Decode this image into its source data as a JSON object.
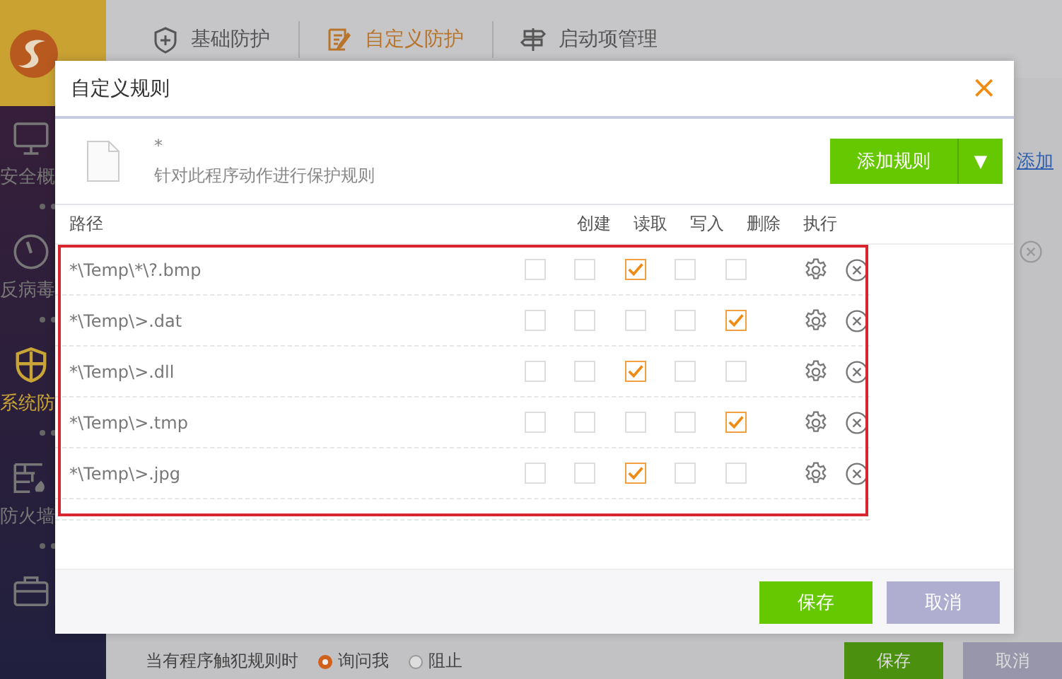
{
  "sidebar": {
    "items": [
      {
        "label": "安全概",
        "selected": false
      },
      {
        "label": "反病毒",
        "selected": false
      },
      {
        "label": "系统防",
        "selected": true
      },
      {
        "label": "防火墙",
        "selected": false
      },
      {
        "selected": false
      }
    ]
  },
  "tabs": [
    {
      "label": "基础防护",
      "selected": false
    },
    {
      "label": "自定义防护",
      "selected": true
    },
    {
      "label": "启动项管理",
      "selected": false
    }
  ],
  "background": {
    "link": "添加",
    "footer_label": "当有程序触犯规则时",
    "radios": [
      {
        "label": "询问我",
        "selected": true
      },
      {
        "label": "阻止",
        "selected": false
      }
    ],
    "buttons": [
      "保存",
      "取消"
    ]
  },
  "dialog": {
    "title": "自定义规则",
    "close": "×",
    "program": {
      "name": "*",
      "description": "针对此程序动作进行保护规则"
    },
    "add_button": "添加规则",
    "add_menu": "▼",
    "columns": [
      "路径",
      "创建",
      "读取",
      "写入",
      "删除",
      "执行"
    ],
    "rows": [
      {
        "path": "*\\Temp\\*\\?.bmp",
        "checks": [
          false,
          false,
          true,
          false,
          false
        ]
      },
      {
        "path": "*\\Temp\\>.dat",
        "checks": [
          false,
          false,
          false,
          false,
          true
        ]
      },
      {
        "path": "*\\Temp\\>.dll",
        "checks": [
          false,
          false,
          true,
          false,
          false
        ]
      },
      {
        "path": "*\\Temp\\>.tmp",
        "checks": [
          false,
          false,
          false,
          false,
          true
        ]
      },
      {
        "path": "*\\Temp\\>.jpg",
        "checks": [
          false,
          false,
          true,
          false,
          false
        ]
      }
    ],
    "buttons": [
      {
        "label": "保存",
        "kind": "primary"
      },
      {
        "label": "取消",
        "kind": "secondary"
      }
    ]
  }
}
